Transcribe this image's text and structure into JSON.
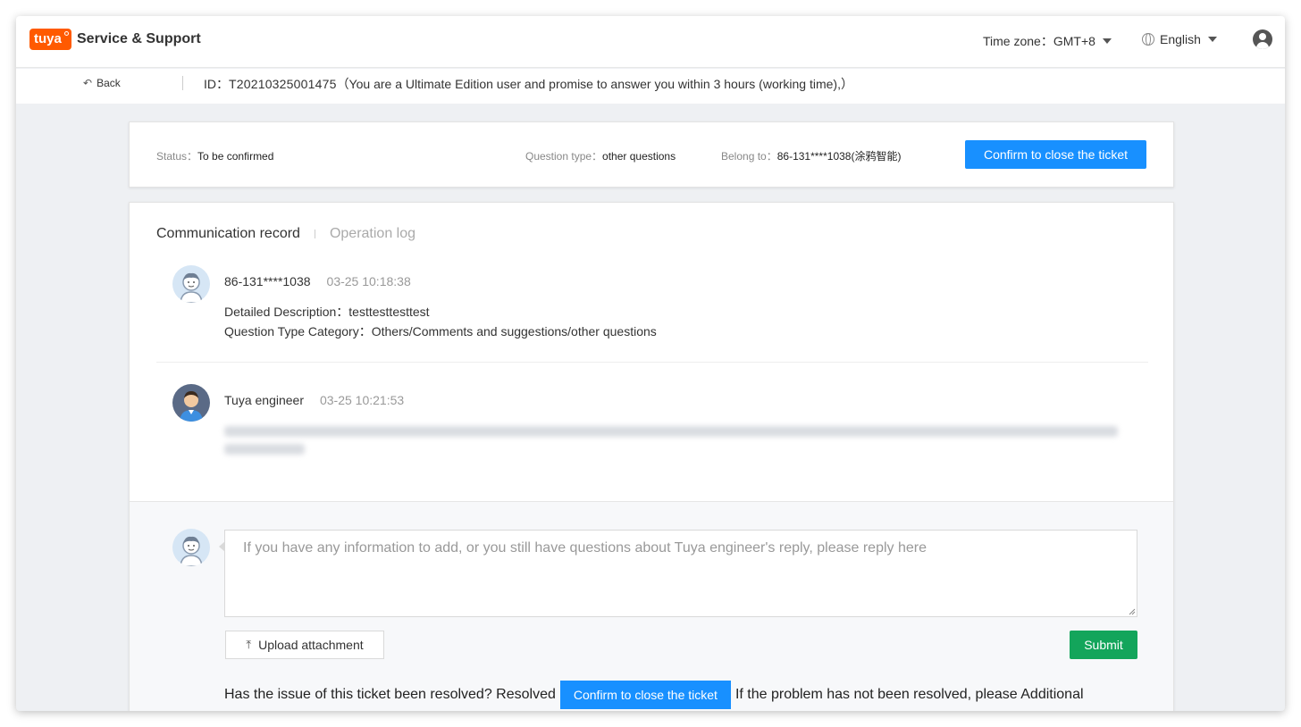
{
  "header": {
    "logo_badge": "tuya",
    "logo_text": "Service & Support",
    "timezone_label": "Time zone：",
    "timezone_value": "GMT+8",
    "language": "English",
    "icons": {
      "timezone_dropdown": "caret-down-icon",
      "globe": "globe-icon",
      "user": "user-account-icon"
    }
  },
  "subheader": {
    "back_label": "Back",
    "id_label": "ID：",
    "id_value": "T20210325001475",
    "id_note": "（You are a Ultimate Edition user and promise to answer you within 3 hours (working time),）"
  },
  "status": {
    "status_label": "Status：",
    "status_value": "To be confirmed",
    "qtype_label": "Question type：",
    "qtype_value": "other questions",
    "belong_label": "Belong to：",
    "belong_value": "86-131****1038(涂鸦智能)",
    "close_button": "Confirm to close the ticket"
  },
  "tabs": [
    {
      "label": "Communication record",
      "active": true
    },
    {
      "label": "Operation log",
      "active": false
    }
  ],
  "messages": [
    {
      "author": "86-131****1038",
      "time": "03-25 10:18:38",
      "desc_label": "Detailed Description：",
      "desc_value": "testtesttesttest",
      "cat_label": "Question Type Category：",
      "cat_value": "Others/Comments and suggestions/other questions"
    },
    {
      "author": "Tuya engineer",
      "time": "03-25 10:21:53"
    }
  ],
  "reply": {
    "placeholder": "If you have any information to add, or you still have questions about Tuya engineer's reply, please reply here",
    "upload_label": "Upload attachment",
    "submit_label": "Submit",
    "resolved_prefix": "Has the issue of this ticket been resolved? Resolved",
    "close_button": "Confirm to close the ticket",
    "resolved_suffix": "If the problem has not been resolved, please Additional"
  },
  "colors": {
    "primary": "#1890ff",
    "submit": "#13a55b",
    "brand": "#ff5a00"
  }
}
